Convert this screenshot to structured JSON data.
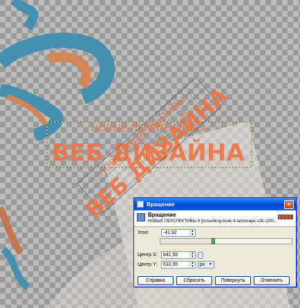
{
  "canvas": {
    "art_text_top": "НОВЫЕ ПЕРСПЕКТИВЫ",
    "art_text_main": "ВЕБ ДИЗАЙНА",
    "text_color": "#f07040",
    "mascot_blue": "#3b8db3",
    "mascot_orange": "#d9824d"
  },
  "dialog": {
    "window_title": "Вращение",
    "header_title": "Вращение",
    "header_subtitle": "НОВЫЕ ПЕРСПЕКТИВЫ-9 ([smashing-book-4-landscape-v2b-1200...",
    "angle_label": "Угол:",
    "angle_value": "-41,92",
    "angle_slider_fraction": 0.4,
    "center_x_label": "Центр X:",
    "center_x_value": "841,50",
    "center_y_label": "Центр Y:",
    "center_y_value": "632,00",
    "units_value": "px",
    "buttons": {
      "help": "Справка",
      "reset": "Сбросить",
      "rotate": "Повернуть",
      "cancel": "Отменить"
    },
    "close_glyph": "×",
    "title_color": "#0054e3"
  }
}
